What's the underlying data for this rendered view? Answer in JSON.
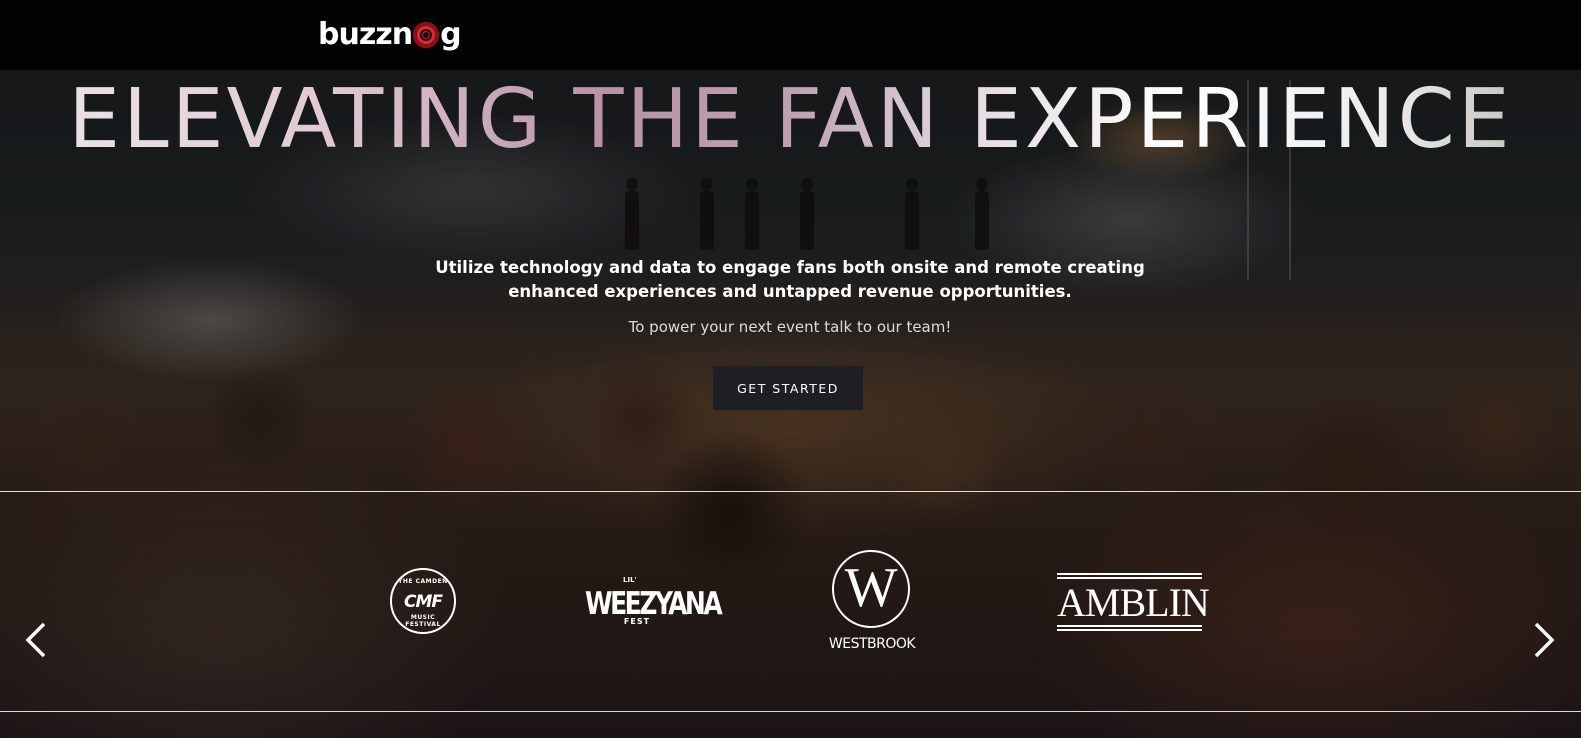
{
  "header": {
    "logo_text_left": "buzzn",
    "logo_text_right": "g"
  },
  "hero": {
    "headline": "ELEVATING THE FAN EXPERIENCE",
    "subhead": "Utilize technology and data to engage fans both onsite and remote creating enhanced experiences and untapped revenue opportunities.",
    "tagline": "To power your next event talk to our team!",
    "cta_label": "GET STARTED"
  },
  "logos": {
    "cmf": {
      "ring_top": "THE CAMDEN",
      "mark": "CMF",
      "ring_bottom": "MUSIC FESTIVAL"
    },
    "weezyana": {
      "lil": "LIL'",
      "main": "WEEZYANA",
      "fest": "FEST"
    },
    "westbrook": {
      "mark": "W",
      "name": "WESTBROOK"
    },
    "amblin": {
      "name": "AMBLIN"
    }
  },
  "carousel": {
    "prev_icon": "chevron-left-icon",
    "next_icon": "chevron-right-icon"
  },
  "colors": {
    "topbar": "#030303",
    "cta_bg": "#1d1f24",
    "logo_red": "#c8202a"
  }
}
